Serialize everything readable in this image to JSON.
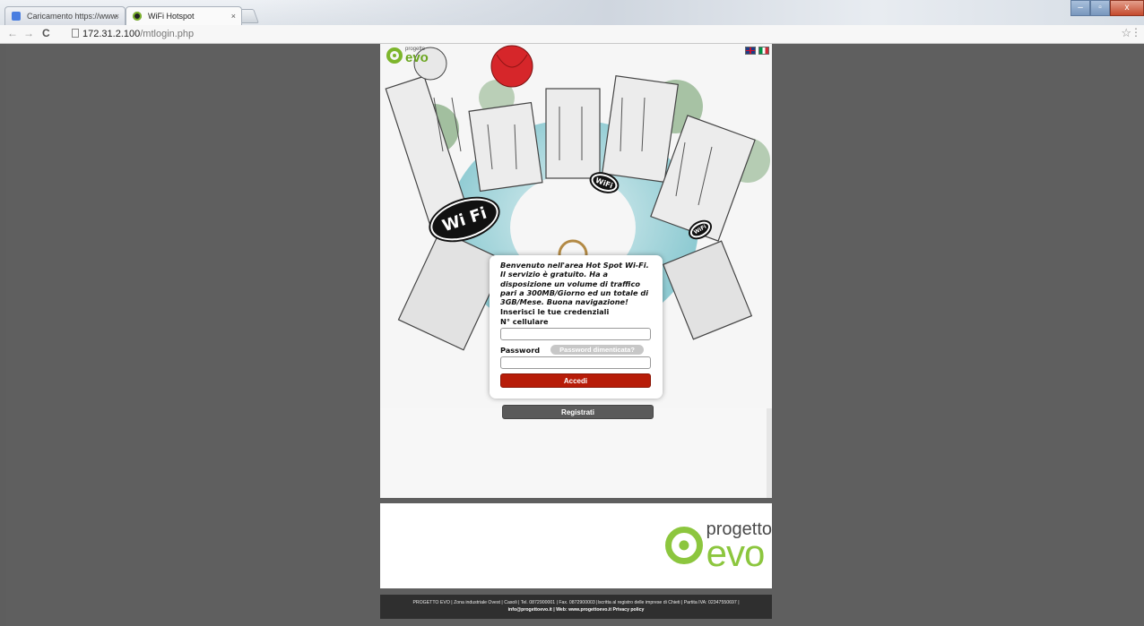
{
  "browser": {
    "tabs": [
      {
        "label": "Caricamento https://www.",
        "active": false
      },
      {
        "label": "WiFi Hotspot",
        "active": true
      }
    ],
    "tab_close": "×",
    "url_host": "172.31.2.100",
    "url_path": "/mtlogin.php",
    "window_buttons": [
      "–",
      "▫",
      "x"
    ]
  },
  "hero": {
    "logo_small_top": "progetto",
    "logo_small_main": "evo",
    "wifi_badges": [
      "Wi Fi",
      "WiFi",
      "WiFi"
    ]
  },
  "login": {
    "welcome": "Benvenuto nell'area Hot Spot Wi-Fi. Il servizio è gratuito. Ha a disposizione un volume di traffico pari a 300MB/Giorno ed un totale di 3GB/Mese. Buona navigazione!",
    "credentials_title": "Inserisci le tue credenziali",
    "phone_label": "N° cellulare",
    "password_label": "Password",
    "forgot_label": "Password dimenticata?",
    "login_label": "Accedi",
    "register_label": "Registrati"
  },
  "footer": {
    "logo_small": "progetto",
    "logo_big": "evo",
    "info_line1": "PROGETTO EVO | Zona industriale Ovest | Casoli | Tel. 0872900001 | Fax. 0872900003 |Iscritta al registro delle imprese di Chieti | Partita IVA: 02347550697 |",
    "info_line2": "info@progettoevo.it | Web: www.progettoevo.it Privacy policy"
  },
  "colors": {
    "brand_green": "#8cc63e",
    "login_red": "#b71c08",
    "register_gray": "#5a5a5a"
  }
}
